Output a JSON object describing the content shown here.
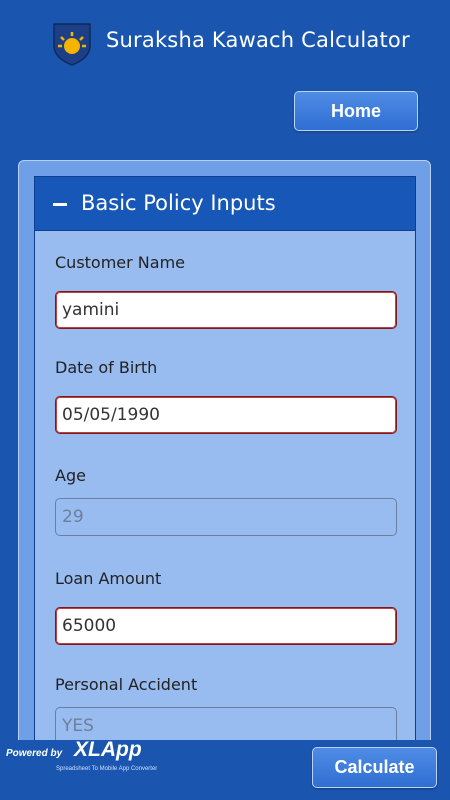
{
  "header": {
    "title": "Suraksha Kawach Calculator",
    "logo_icon": "sun-shield-logo"
  },
  "nav": {
    "home_label": "Home"
  },
  "panel": {
    "title": "Basic Policy Inputs",
    "toggle_icon": "minus-icon"
  },
  "fields": [
    {
      "label": "Customer Name",
      "value": "yamini",
      "editable": true
    },
    {
      "label": "Date of Birth",
      "value": "05/05/1990",
      "editable": true
    },
    {
      "label": "Age",
      "value": "29",
      "editable": false
    },
    {
      "label": "Loan Amount",
      "value": "65000",
      "editable": true
    },
    {
      "label": "Personal Accident",
      "value": "YES",
      "editable": false
    }
  ],
  "footer": {
    "powered_by": "Powered by",
    "brand_xl": "XL",
    "brand_app": "App",
    "tagline": "Spreadsheet To Mobile App Converter",
    "calculate_label": "Calculate"
  },
  "colors": {
    "background": "#1a56b0",
    "panel_header": "#1657b8",
    "panel_body": "#98bcf0",
    "button": "#3a7bdb"
  }
}
